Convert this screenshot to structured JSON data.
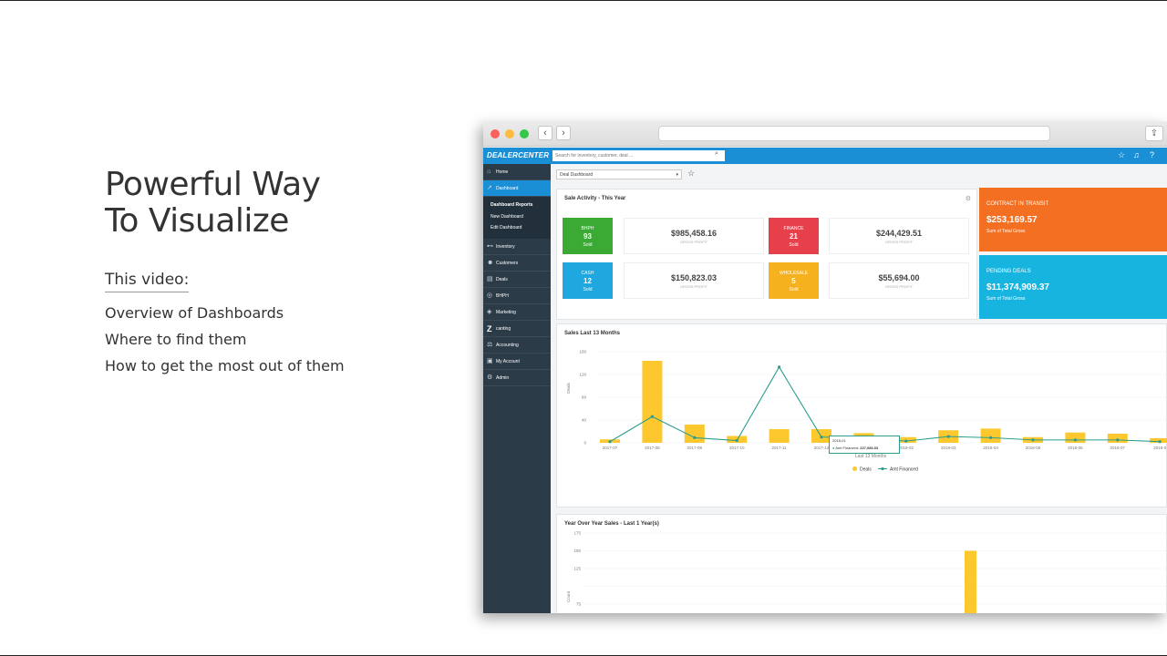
{
  "slide": {
    "title": "Powerful Way\nTo Visualize",
    "video_label": "This video:",
    "topics": [
      "Overview of Dashboards",
      "Where to find them",
      "How to get the most out of them"
    ]
  },
  "browser": {
    "nav_back": "‹",
    "nav_forward": "›",
    "share_icon": "share-icon"
  },
  "app": {
    "logo": "DEALERCENTER",
    "search_placeholder": "Search for inventory, customer, deal ...",
    "sidebar": {
      "items": [
        {
          "label": "Home",
          "icon": "home-icon"
        },
        {
          "label": "Dashboard",
          "icon": "chart-icon"
        },
        {
          "label": "Inventory",
          "icon": "car-icon"
        },
        {
          "label": "Customers",
          "icon": "users-icon"
        },
        {
          "label": "Deals",
          "icon": "document-icon"
        },
        {
          "label": "BHPH",
          "icon": "bhph-icon"
        },
        {
          "label": "Marketing",
          "icon": "tag-icon"
        },
        {
          "label": "canting",
          "icon": "z-icon"
        },
        {
          "label": "Accounting",
          "icon": "scale-icon"
        },
        {
          "label": "My Account",
          "icon": "account-icon"
        },
        {
          "label": "Admin",
          "icon": "gear-icon"
        }
      ],
      "sub_header": "Dashboard Reports",
      "sub_items": [
        "New Dashboard",
        "Edit Dashboard"
      ]
    },
    "dashboard_select": "Deal Dashboard",
    "sale_activity": {
      "title": "Sale Activity - This Year",
      "tiles": [
        {
          "label": "BHPH",
          "value": "93",
          "sub": "Sold",
          "color": "#3aaa35",
          "amount": "$985,458.16",
          "amount_label": "GROSS PROFIT"
        },
        {
          "label": "FINANCE",
          "value": "21",
          "sub": "Sold",
          "color": "#e8404a",
          "amount": "$244,429.51",
          "amount_label": "GROSS PROFIT"
        },
        {
          "label": "CASH",
          "value": "12",
          "sub": "Sold",
          "color": "#1fa8e0",
          "amount": "$150,823.03",
          "amount_label": "GROSS PROFIT"
        },
        {
          "label": "WHOLESALE",
          "value": "5",
          "sub": "Sold",
          "color": "#f5b21e",
          "amount": "$55,694.00",
          "amount_label": "GROSS PROFIT"
        }
      ]
    },
    "kpis": [
      {
        "title": "CONTRACT IN TRANSIT",
        "value": "$253,169.57",
        "sub": "Sum of Total Gross",
        "color": "#f36f21"
      },
      {
        "title": "PENDING DEALS",
        "value": "$11,374,909.37",
        "sub": "Sum of Total Gross",
        "color": "#17b4e0"
      }
    ],
    "tooltip": {
      "date": "2018-01",
      "label": "Amt Financed:",
      "value": "227,086.03"
    }
  },
  "chart_data": [
    {
      "type": "bar",
      "title": "Sales Last 13 Months",
      "xlabel": "Last 13 Months",
      "ylabel": "Deals",
      "ylim": [
        0,
        160
      ],
      "yticks": [
        0,
        40,
        80,
        120,
        160
      ],
      "categories": [
        "2017-07",
        "2017-08",
        "2017-09",
        "2017-10",
        "2017-11",
        "2017-12",
        "2018-01",
        "2018-02",
        "2018-03",
        "2018-04",
        "2018-05",
        "2018-06",
        "2018-07",
        "2018-0"
      ],
      "series": [
        {
          "name": "Deals",
          "type": "bar",
          "color": "#fcc82e",
          "values": [
            6,
            144,
            32,
            12,
            24,
            24,
            17,
            10,
            22,
            25,
            10,
            18,
            16,
            8
          ]
        },
        {
          "name": "Amt Financed",
          "type": "line",
          "color": "#2a9d8f",
          "values": [
            2,
            46,
            9,
            4,
            133,
            10,
            9,
            3,
            11,
            9,
            5,
            5,
            5,
            2
          ]
        }
      ],
      "legend": "bottom-center"
    },
    {
      "type": "bar",
      "title": "Year Over Year Sales - Last 1 Year(s)",
      "ylabel": "Count",
      "ylim": [
        75,
        175
      ],
      "yticks": [
        75,
        100,
        125,
        150,
        175
      ],
      "yticks_labels": [
        "75",
        "",
        "125",
        "150",
        "175"
      ],
      "categories": [
        ""
      ],
      "series": [
        {
          "name": "",
          "type": "bar",
          "color": "#fcc82e",
          "values": [
            150
          ]
        }
      ]
    }
  ]
}
